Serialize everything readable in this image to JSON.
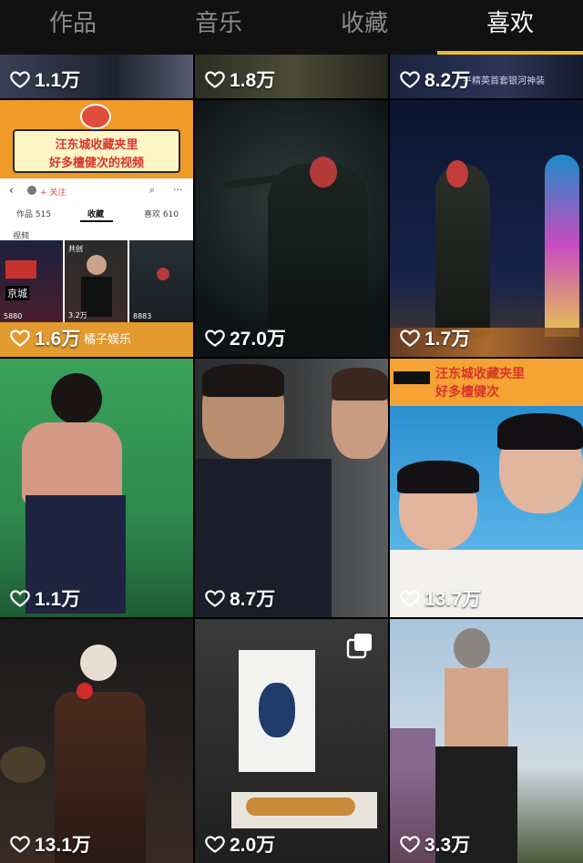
{
  "tabs": [
    {
      "label": "作品",
      "active": false
    },
    {
      "label": "音乐",
      "active": false
    },
    {
      "label": "收藏",
      "active": false
    },
    {
      "label": "喜欢",
      "active": true
    }
  ],
  "accent_color": "#e9bd2e",
  "grid": [
    {
      "likes": "1.1万"
    },
    {
      "likes": "1.8万"
    },
    {
      "likes": "8.2万",
      "caption": "平精英首套银河神装"
    },
    {
      "likes": "1.6万",
      "banner_line1": "汪东城收藏夹里",
      "banner_line2": "好多檀健次的视频",
      "profile": {
        "follow": "+ 关注",
        "tab_works": "作品 515",
        "tab_fav": "收藏",
        "tab_likes": "喜欢 610",
        "sub_tab": "视频",
        "thumb_counts": [
          "5880",
          "3.2万",
          "8883"
        ],
        "thumb_labels": [
          "京城",
          "共创"
        ]
      },
      "brand": "橘子娱乐"
    },
    {
      "likes": "27.0万"
    },
    {
      "likes": "1.7万"
    },
    {
      "likes": "1.1万"
    },
    {
      "likes": "8.7万"
    },
    {
      "likes": "13.7万",
      "banner_line1": "汪东城收藏夹里",
      "banner_line2": "好多檀健次"
    },
    {
      "likes": "13.1万"
    },
    {
      "likes": "2.0万",
      "multi_image": true
    },
    {
      "likes": "3.3万"
    }
  ]
}
